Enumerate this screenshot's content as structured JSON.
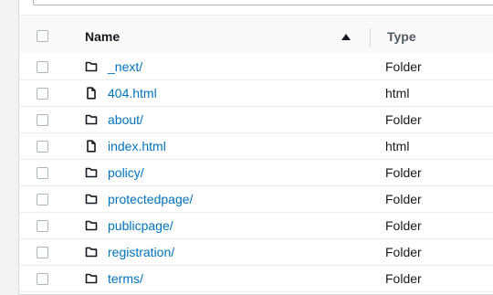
{
  "table": {
    "columns": {
      "name": "Name",
      "type": "Type"
    },
    "sort": {
      "column": "Name",
      "direction": "ascending"
    },
    "rows": [
      {
        "name": "_next/",
        "type": "Folder",
        "icon": "folder-icon"
      },
      {
        "name": "404.html",
        "type": "html",
        "icon": "file-icon"
      },
      {
        "name": "about/",
        "type": "Folder",
        "icon": "folder-icon"
      },
      {
        "name": "index.html",
        "type": "html",
        "icon": "file-icon"
      },
      {
        "name": "policy/",
        "type": "Folder",
        "icon": "folder-icon"
      },
      {
        "name": "protectedpage/",
        "type": "Folder",
        "icon": "folder-icon"
      },
      {
        "name": "publicpage/",
        "type": "Folder",
        "icon": "folder-icon"
      },
      {
        "name": "registration/",
        "type": "Folder",
        "icon": "folder-icon"
      },
      {
        "name": "terms/",
        "type": "Folder",
        "icon": "folder-icon"
      }
    ]
  },
  "colors": {
    "link": "#0073bb",
    "text": "#16191f",
    "border": "#eaeded"
  }
}
